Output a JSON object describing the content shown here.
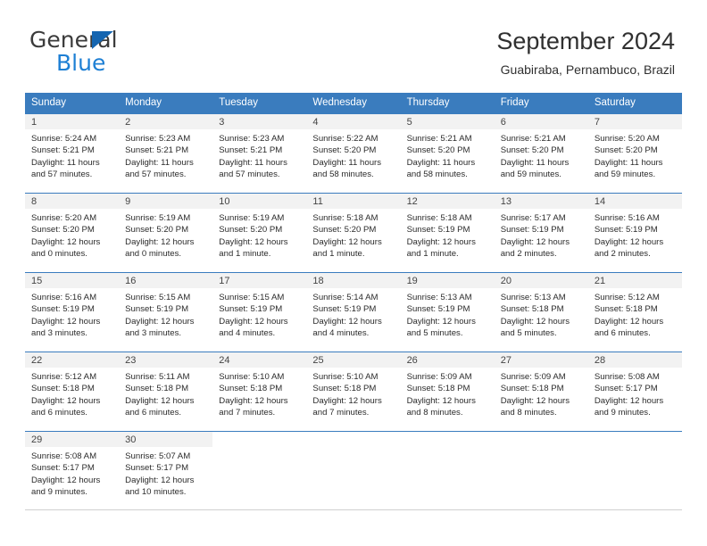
{
  "brand": {
    "general": "General",
    "blue": "Blue",
    "triangle_color": "#1565b0",
    "blue_color": "#1d7fd4"
  },
  "title": {
    "month_year": "September 2024",
    "location": "Guabiraba, Pernambuco, Brazil"
  },
  "theme": {
    "header_bg": "#3a7cbe",
    "header_text": "#ffffff",
    "daynum_bg": "#f2f2f2",
    "cell_text": "#2b2b2b"
  },
  "weekday_headers": [
    "Sunday",
    "Monday",
    "Tuesday",
    "Wednesday",
    "Thursday",
    "Friday",
    "Saturday"
  ],
  "weeks": [
    [
      {
        "day": "1",
        "sunrise": "Sunrise: 5:24 AM",
        "sunset": "Sunset: 5:21 PM",
        "daylight1": "Daylight: 11 hours",
        "daylight2": "and 57 minutes."
      },
      {
        "day": "2",
        "sunrise": "Sunrise: 5:23 AM",
        "sunset": "Sunset: 5:21 PM",
        "daylight1": "Daylight: 11 hours",
        "daylight2": "and 57 minutes."
      },
      {
        "day": "3",
        "sunrise": "Sunrise: 5:23 AM",
        "sunset": "Sunset: 5:21 PM",
        "daylight1": "Daylight: 11 hours",
        "daylight2": "and 57 minutes."
      },
      {
        "day": "4",
        "sunrise": "Sunrise: 5:22 AM",
        "sunset": "Sunset: 5:20 PM",
        "daylight1": "Daylight: 11 hours",
        "daylight2": "and 58 minutes."
      },
      {
        "day": "5",
        "sunrise": "Sunrise: 5:21 AM",
        "sunset": "Sunset: 5:20 PM",
        "daylight1": "Daylight: 11 hours",
        "daylight2": "and 58 minutes."
      },
      {
        "day": "6",
        "sunrise": "Sunrise: 5:21 AM",
        "sunset": "Sunset: 5:20 PM",
        "daylight1": "Daylight: 11 hours",
        "daylight2": "and 59 minutes."
      },
      {
        "day": "7",
        "sunrise": "Sunrise: 5:20 AM",
        "sunset": "Sunset: 5:20 PM",
        "daylight1": "Daylight: 11 hours",
        "daylight2": "and 59 minutes."
      }
    ],
    [
      {
        "day": "8",
        "sunrise": "Sunrise: 5:20 AM",
        "sunset": "Sunset: 5:20 PM",
        "daylight1": "Daylight: 12 hours",
        "daylight2": "and 0 minutes."
      },
      {
        "day": "9",
        "sunrise": "Sunrise: 5:19 AM",
        "sunset": "Sunset: 5:20 PM",
        "daylight1": "Daylight: 12 hours",
        "daylight2": "and 0 minutes."
      },
      {
        "day": "10",
        "sunrise": "Sunrise: 5:19 AM",
        "sunset": "Sunset: 5:20 PM",
        "daylight1": "Daylight: 12 hours",
        "daylight2": "and 1 minute."
      },
      {
        "day": "11",
        "sunrise": "Sunrise: 5:18 AM",
        "sunset": "Sunset: 5:20 PM",
        "daylight1": "Daylight: 12 hours",
        "daylight2": "and 1 minute."
      },
      {
        "day": "12",
        "sunrise": "Sunrise: 5:18 AM",
        "sunset": "Sunset: 5:19 PM",
        "daylight1": "Daylight: 12 hours",
        "daylight2": "and 1 minute."
      },
      {
        "day": "13",
        "sunrise": "Sunrise: 5:17 AM",
        "sunset": "Sunset: 5:19 PM",
        "daylight1": "Daylight: 12 hours",
        "daylight2": "and 2 minutes."
      },
      {
        "day": "14",
        "sunrise": "Sunrise: 5:16 AM",
        "sunset": "Sunset: 5:19 PM",
        "daylight1": "Daylight: 12 hours",
        "daylight2": "and 2 minutes."
      }
    ],
    [
      {
        "day": "15",
        "sunrise": "Sunrise: 5:16 AM",
        "sunset": "Sunset: 5:19 PM",
        "daylight1": "Daylight: 12 hours",
        "daylight2": "and 3 minutes."
      },
      {
        "day": "16",
        "sunrise": "Sunrise: 5:15 AM",
        "sunset": "Sunset: 5:19 PM",
        "daylight1": "Daylight: 12 hours",
        "daylight2": "and 3 minutes."
      },
      {
        "day": "17",
        "sunrise": "Sunrise: 5:15 AM",
        "sunset": "Sunset: 5:19 PM",
        "daylight1": "Daylight: 12 hours",
        "daylight2": "and 4 minutes."
      },
      {
        "day": "18",
        "sunrise": "Sunrise: 5:14 AM",
        "sunset": "Sunset: 5:19 PM",
        "daylight1": "Daylight: 12 hours",
        "daylight2": "and 4 minutes."
      },
      {
        "day": "19",
        "sunrise": "Sunrise: 5:13 AM",
        "sunset": "Sunset: 5:19 PM",
        "daylight1": "Daylight: 12 hours",
        "daylight2": "and 5 minutes."
      },
      {
        "day": "20",
        "sunrise": "Sunrise: 5:13 AM",
        "sunset": "Sunset: 5:18 PM",
        "daylight1": "Daylight: 12 hours",
        "daylight2": "and 5 minutes."
      },
      {
        "day": "21",
        "sunrise": "Sunrise: 5:12 AM",
        "sunset": "Sunset: 5:18 PM",
        "daylight1": "Daylight: 12 hours",
        "daylight2": "and 6 minutes."
      }
    ],
    [
      {
        "day": "22",
        "sunrise": "Sunrise: 5:12 AM",
        "sunset": "Sunset: 5:18 PM",
        "daylight1": "Daylight: 12 hours",
        "daylight2": "and 6 minutes."
      },
      {
        "day": "23",
        "sunrise": "Sunrise: 5:11 AM",
        "sunset": "Sunset: 5:18 PM",
        "daylight1": "Daylight: 12 hours",
        "daylight2": "and 6 minutes."
      },
      {
        "day": "24",
        "sunrise": "Sunrise: 5:10 AM",
        "sunset": "Sunset: 5:18 PM",
        "daylight1": "Daylight: 12 hours",
        "daylight2": "and 7 minutes."
      },
      {
        "day": "25",
        "sunrise": "Sunrise: 5:10 AM",
        "sunset": "Sunset: 5:18 PM",
        "daylight1": "Daylight: 12 hours",
        "daylight2": "and 7 minutes."
      },
      {
        "day": "26",
        "sunrise": "Sunrise: 5:09 AM",
        "sunset": "Sunset: 5:18 PM",
        "daylight1": "Daylight: 12 hours",
        "daylight2": "and 8 minutes."
      },
      {
        "day": "27",
        "sunrise": "Sunrise: 5:09 AM",
        "sunset": "Sunset: 5:18 PM",
        "daylight1": "Daylight: 12 hours",
        "daylight2": "and 8 minutes."
      },
      {
        "day": "28",
        "sunrise": "Sunrise: 5:08 AM",
        "sunset": "Sunset: 5:17 PM",
        "daylight1": "Daylight: 12 hours",
        "daylight2": "and 9 minutes."
      }
    ],
    [
      {
        "day": "29",
        "sunrise": "Sunrise: 5:08 AM",
        "sunset": "Sunset: 5:17 PM",
        "daylight1": "Daylight: 12 hours",
        "daylight2": "and 9 minutes."
      },
      {
        "day": "30",
        "sunrise": "Sunrise: 5:07 AM",
        "sunset": "Sunset: 5:17 PM",
        "daylight1": "Daylight: 12 hours",
        "daylight2": "and 10 minutes."
      },
      {
        "day": "",
        "sunrise": "",
        "sunset": "",
        "daylight1": "",
        "daylight2": ""
      },
      {
        "day": "",
        "sunrise": "",
        "sunset": "",
        "daylight1": "",
        "daylight2": ""
      },
      {
        "day": "",
        "sunrise": "",
        "sunset": "",
        "daylight1": "",
        "daylight2": ""
      },
      {
        "day": "",
        "sunrise": "",
        "sunset": "",
        "daylight1": "",
        "daylight2": ""
      },
      {
        "day": "",
        "sunrise": "",
        "sunset": "",
        "daylight1": "",
        "daylight2": ""
      }
    ]
  ]
}
